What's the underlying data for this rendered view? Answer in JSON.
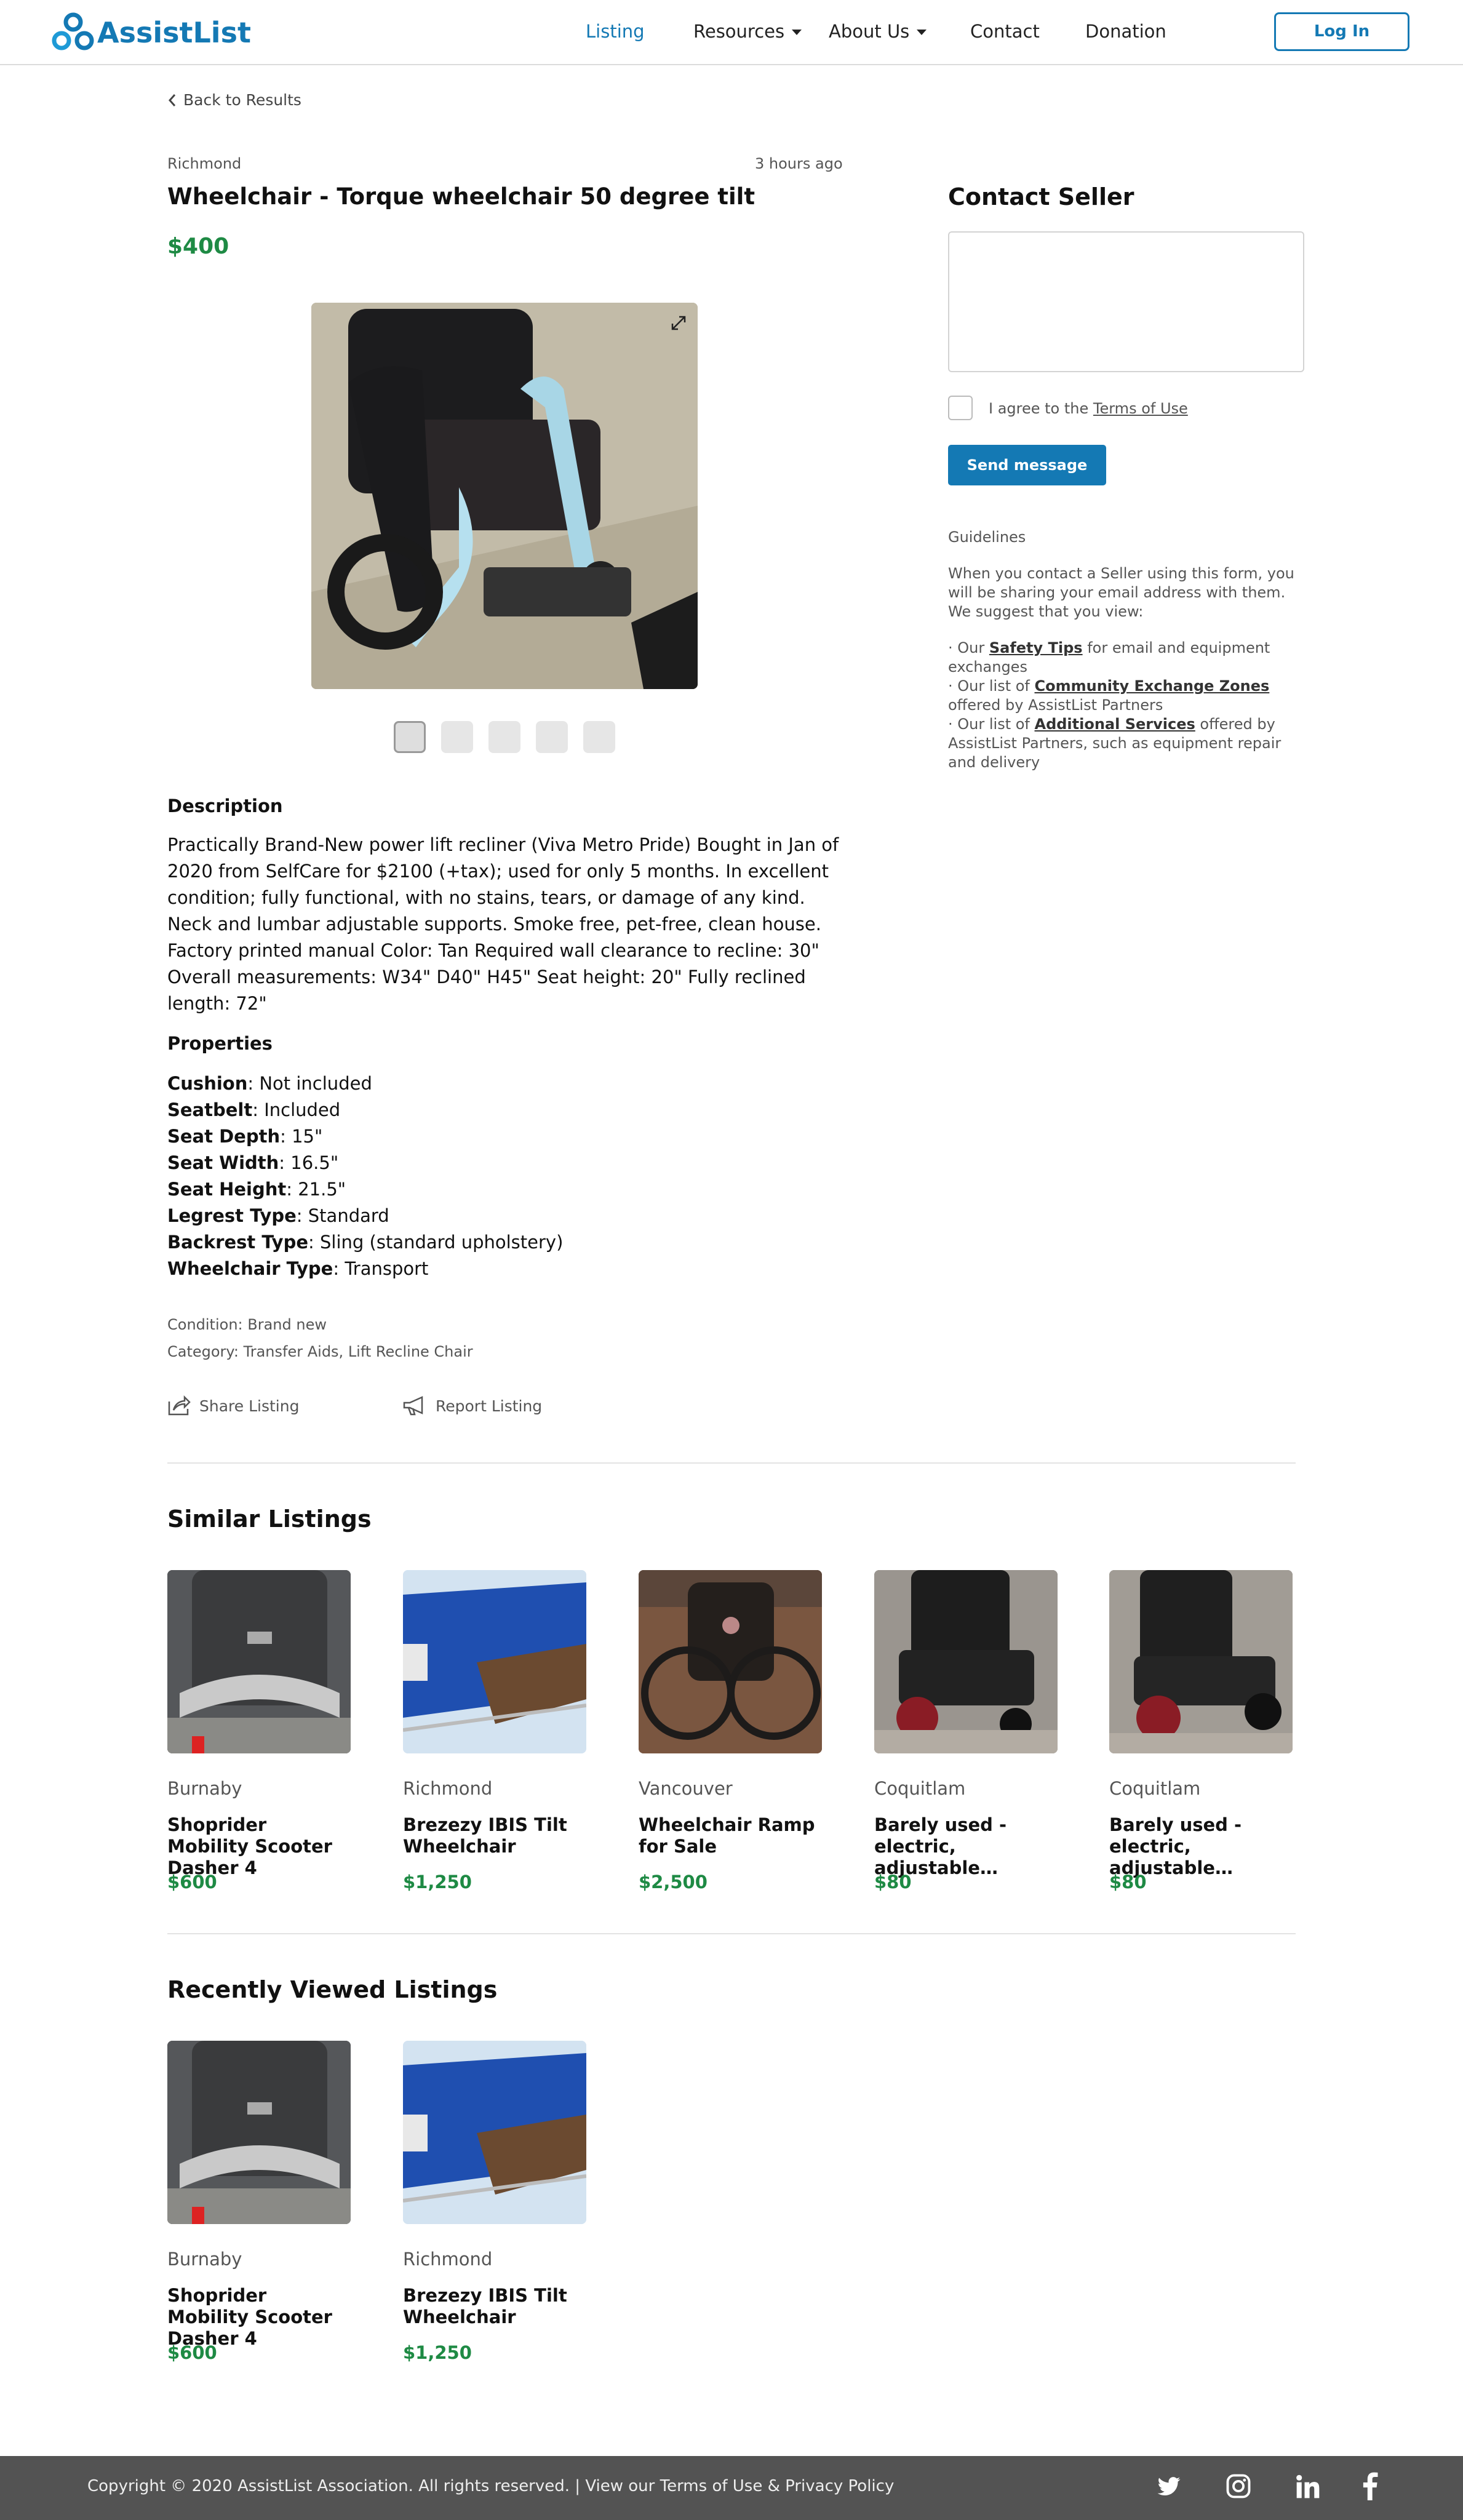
{
  "header": {
    "logo_text": "AssistList",
    "nav": [
      "Listing",
      "Resources",
      "About Us",
      "Contact",
      "Donation"
    ],
    "login_label": "Log In",
    "active_color": "#1479b4"
  },
  "back_link": "Back to Results",
  "listing": {
    "location": "Richmond",
    "posted": "3 hours ago",
    "title": "Wheelchair - Torque wheelchair 50 degree tilt",
    "price": "$400",
    "description_heading": "Description",
    "description": "Practically Brand-New power lift recliner (Viva Metro Pride) Bought in Jan of 2020 from SelfCare for $2100 (+tax); used for only 5 months. In excellent condition; fully functional, with no stains, tears, or damage of any kind. Neck and lumbar adjustable supports.  Smoke free, pet-free, clean house.  Factory printed manual Color: Tan Required wall clearance to recline: 30\" Overall measurements: W34\" D40\" H45\"  Seat height: 20\" Fully reclined length: 72\"",
    "properties_heading": "Properties",
    "properties": [
      {
        "label": "Cushion",
        "value": ": Not included"
      },
      {
        "label": "Seatbelt",
        "value": ": Included"
      },
      {
        "label": "Seat Depth",
        "value": ": 15\""
      },
      {
        "label": "Seat Width",
        "value": ": 16.5\""
      },
      {
        "label": "Seat Height",
        "value": ": 21.5\""
      },
      {
        "label": "Legrest Type",
        "value": ": Standard"
      },
      {
        "label": "Backrest Type",
        "value": ": Sling (standard upholstery)"
      },
      {
        "label": "Wheelchair Type",
        "value": ": Transport"
      }
    ],
    "condition": "Condition:  Brand new",
    "category": "Category: Transfer Aids, Lift Recline Chair",
    "share_label": "Share Listing",
    "report_label": "Report Listing"
  },
  "contact": {
    "heading": "Contact Seller",
    "agree_prefix": "I agree to the ",
    "agree_link": "Terms of Use",
    "send_label": "Send message",
    "guidelines_heading": "Guidelines",
    "guidelines_intro": "When you contact a Seller using this form, you will be sharing your email address with them. We suggest that you view:",
    "bullets": [
      {
        "prefix": "· Our ",
        "link": "Safety Tips",
        "suffix": " for email and equipment exchanges"
      },
      {
        "prefix": "· Our list of ",
        "link": "Community Exchange Zones",
        "suffix": " offered by AssistList Partners"
      },
      {
        "prefix": "· Our list of ",
        "link": "Additional Services",
        "suffix": " offered by AssistList Partners, such as equipment repair and delivery"
      }
    ]
  },
  "similar": {
    "heading": "Similar Listings",
    "items": [
      {
        "location": "Burnaby",
        "title": "Shoprider Mobility Scooter Dasher 4",
        "price": "$600"
      },
      {
        "location": "Richmond",
        "title": "Brezezy IBIS Tilt Wheelchair",
        "price": "$1,250"
      },
      {
        "location": "Vancouver",
        "title": "Wheelchair Ramp for Sale",
        "price": "$2,500"
      },
      {
        "location": "Coquitlam",
        "title": "Barely used - electric, adjustable…",
        "price": "$80"
      },
      {
        "location": "Coquitlam",
        "title": "Barely used - electric, adjustable…",
        "price": "$80"
      }
    ]
  },
  "recent": {
    "heading": "Recently Viewed Listings",
    "items": [
      {
        "location": "Burnaby",
        "title": "Shoprider Mobility Scooter Dasher 4",
        "price": "$600"
      },
      {
        "location": "Richmond",
        "title": "Brezezy IBIS Tilt Wheelchair",
        "price": "$1,250"
      }
    ]
  },
  "footer": {
    "copyright": "Copyright © 2020 AssistList Association. All rights reserved. | View our Terms of Use & Privacy Policy",
    "social": [
      "twitter-icon",
      "instagram-icon",
      "linkedin-icon",
      "facebook-icon"
    ]
  }
}
